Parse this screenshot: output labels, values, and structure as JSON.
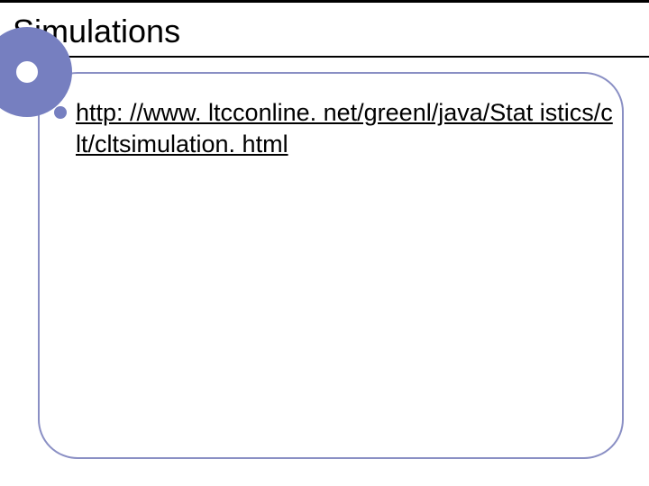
{
  "slide": {
    "title": "Simulations",
    "bullets": [
      {
        "link_text": "http: //www. ltcconline. net/greenl/java/Stat istics/clt/cltsimulation. html"
      }
    ]
  }
}
